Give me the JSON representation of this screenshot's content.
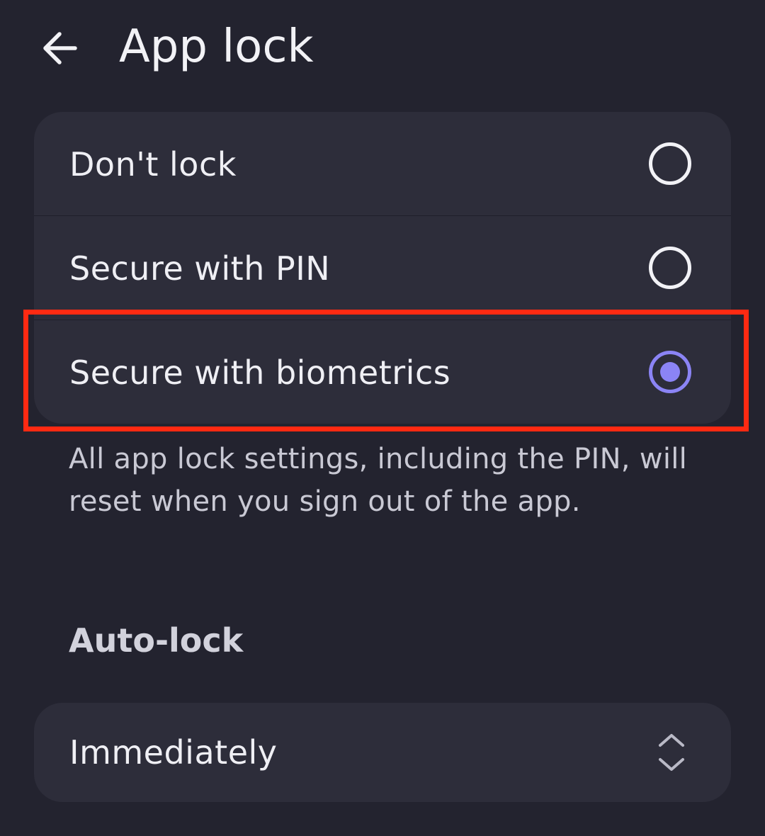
{
  "header": {
    "back_icon": "arrow-left-icon",
    "title": "App lock"
  },
  "lock_options": {
    "items": [
      {
        "label": "Don't lock",
        "selected": false
      },
      {
        "label": "Secure with PIN",
        "selected": false
      },
      {
        "label": "Secure with biometrics",
        "selected": true
      }
    ],
    "note": "All app lock settings, including the PIN, will reset when you sign out of the app."
  },
  "auto_lock": {
    "title": "Auto-lock",
    "selected_value": "Immediately",
    "icon": "unfold-chevrons-icon"
  },
  "colors": {
    "background": "#23232f",
    "card": "#2d2d3a",
    "accent": "#8b84f5",
    "highlight": "#ff2a12"
  }
}
